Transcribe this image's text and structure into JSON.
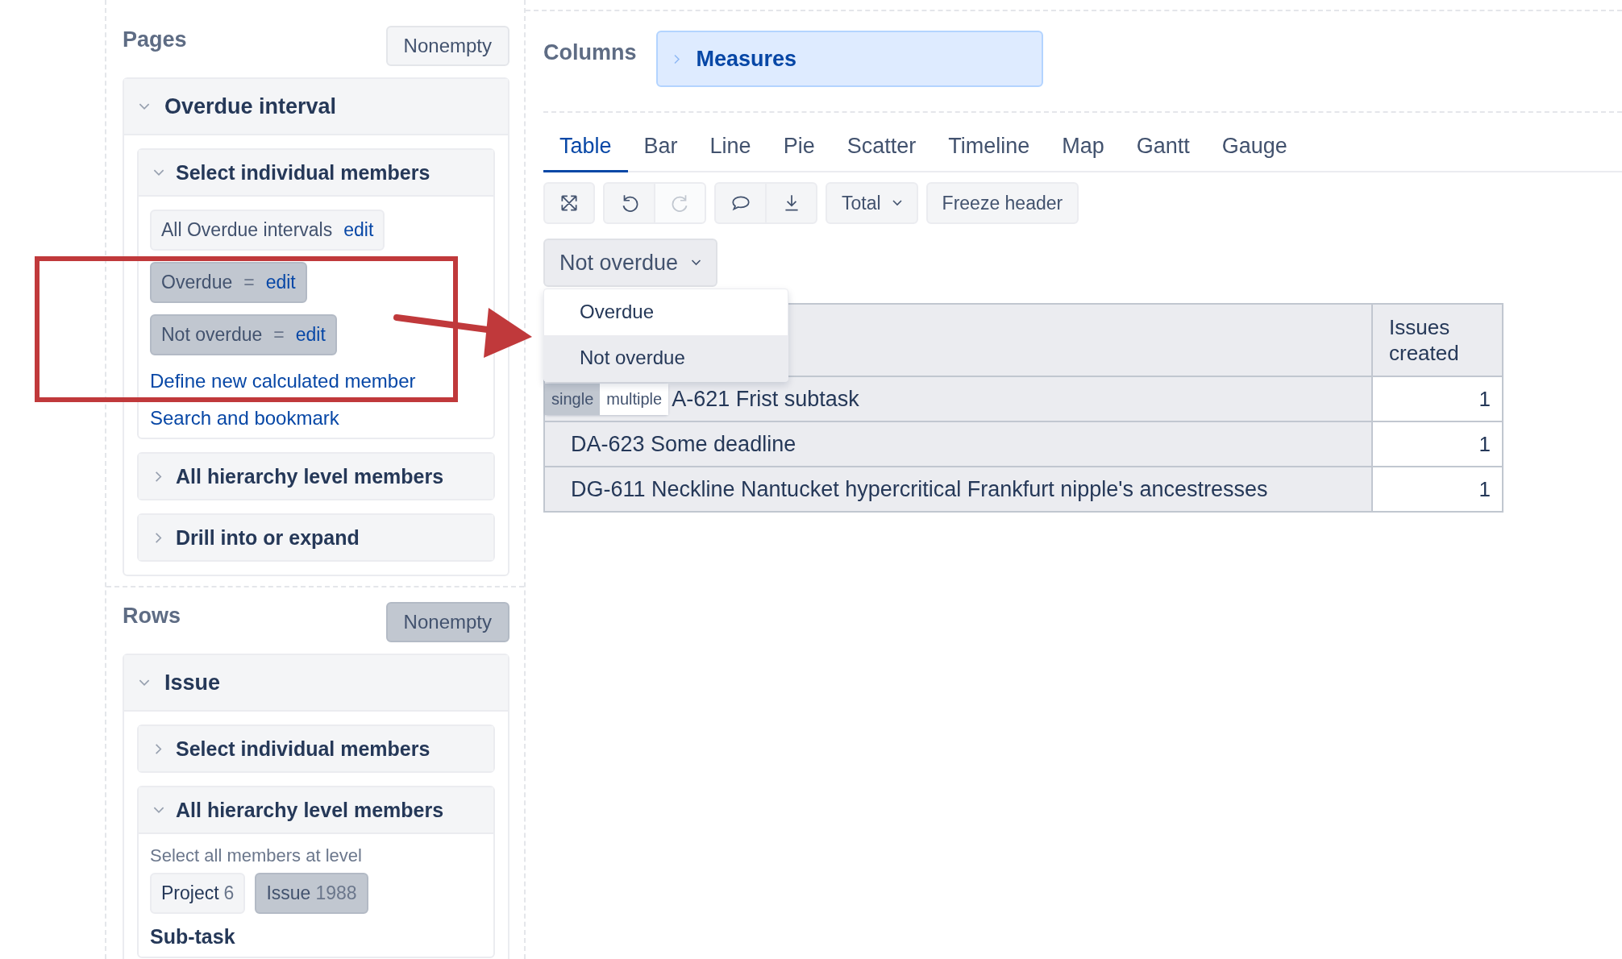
{
  "pages": {
    "title": "Pages",
    "nonempty": {
      "label": "Nonempty",
      "selected": false
    },
    "dimension": {
      "title": "Overdue interval",
      "expanded": true,
      "sections": [
        {
          "kind": "members",
          "title": "Select individual members",
          "expanded": true,
          "members": [
            {
              "label": "All Overdue intervals",
              "edit": "edit",
              "selected": false
            },
            {
              "label": "Overdue",
              "operator": "=",
              "edit": "edit",
              "selected": true
            },
            {
              "label": "Not overdue",
              "operator": "=",
              "edit": "edit",
              "selected": true
            }
          ],
          "links": [
            "Define new calculated member",
            "Search and bookmark"
          ]
        },
        {
          "kind": "plain",
          "title": "All hierarchy level members",
          "expanded": false
        },
        {
          "kind": "plain",
          "title": "Drill into or expand",
          "expanded": false
        }
      ]
    }
  },
  "rows": {
    "title": "Rows",
    "nonempty": {
      "label": "Nonempty",
      "selected": true
    },
    "dimension": {
      "title": "Issue",
      "expanded": true,
      "sections": [
        {
          "kind": "plain",
          "title": "Select individual members",
          "expanded": false
        },
        {
          "kind": "level",
          "title": "All hierarchy level members",
          "expanded": true,
          "hint": "Select all members at level",
          "levels": [
            {
              "label": "Project",
              "count": "6",
              "selected": false
            },
            {
              "label": "Issue",
              "count": "1988",
              "selected": true
            }
          ],
          "next_level": "Sub-task"
        }
      ]
    }
  },
  "columns": {
    "title": "Columns",
    "items": [
      {
        "label": "Measures",
        "expanded": false
      }
    ]
  },
  "tabs": [
    {
      "label": "Table",
      "selected": true
    },
    {
      "label": "Bar",
      "selected": false
    },
    {
      "label": "Line",
      "selected": false
    },
    {
      "label": "Pie",
      "selected": false
    },
    {
      "label": "Scatter",
      "selected": false
    },
    {
      "label": "Timeline",
      "selected": false
    },
    {
      "label": "Map",
      "selected": false
    },
    {
      "label": "Gantt",
      "selected": false
    },
    {
      "label": "Gauge",
      "selected": false
    }
  ],
  "toolbar": {
    "groups": [
      {
        "buttons": [
          {
            "kind": "fullscreen",
            "disabled": false
          }
        ]
      },
      {
        "buttons": [
          {
            "kind": "undo",
            "disabled": false
          },
          {
            "kind": "redo",
            "disabled": true
          }
        ]
      },
      {
        "buttons": [
          {
            "kind": "comment",
            "disabled": false
          },
          {
            "kind": "download",
            "disabled": false
          }
        ]
      }
    ],
    "total": "Total",
    "freeze": "Freeze header"
  },
  "page_select": {
    "value": "Not overdue",
    "expanded": true,
    "options": [
      {
        "label": "Overdue",
        "selected": false
      },
      {
        "label": "Not overdue",
        "selected": true
      }
    ]
  },
  "table": {
    "value_column": "Issues created",
    "rows": [
      {
        "name": "A-621 Frist subtask",
        "value": "1",
        "selection_mode": [
          {
            "label": "single",
            "selected": true
          },
          {
            "label": "multiple",
            "selected": false
          }
        ]
      },
      {
        "name": "DA-623 Some deadline",
        "value": "1"
      },
      {
        "name": "DG-611 Neckline Nantucket hypercritical Frankfurt nipple's ancestresses",
        "value": "1"
      }
    ]
  }
}
